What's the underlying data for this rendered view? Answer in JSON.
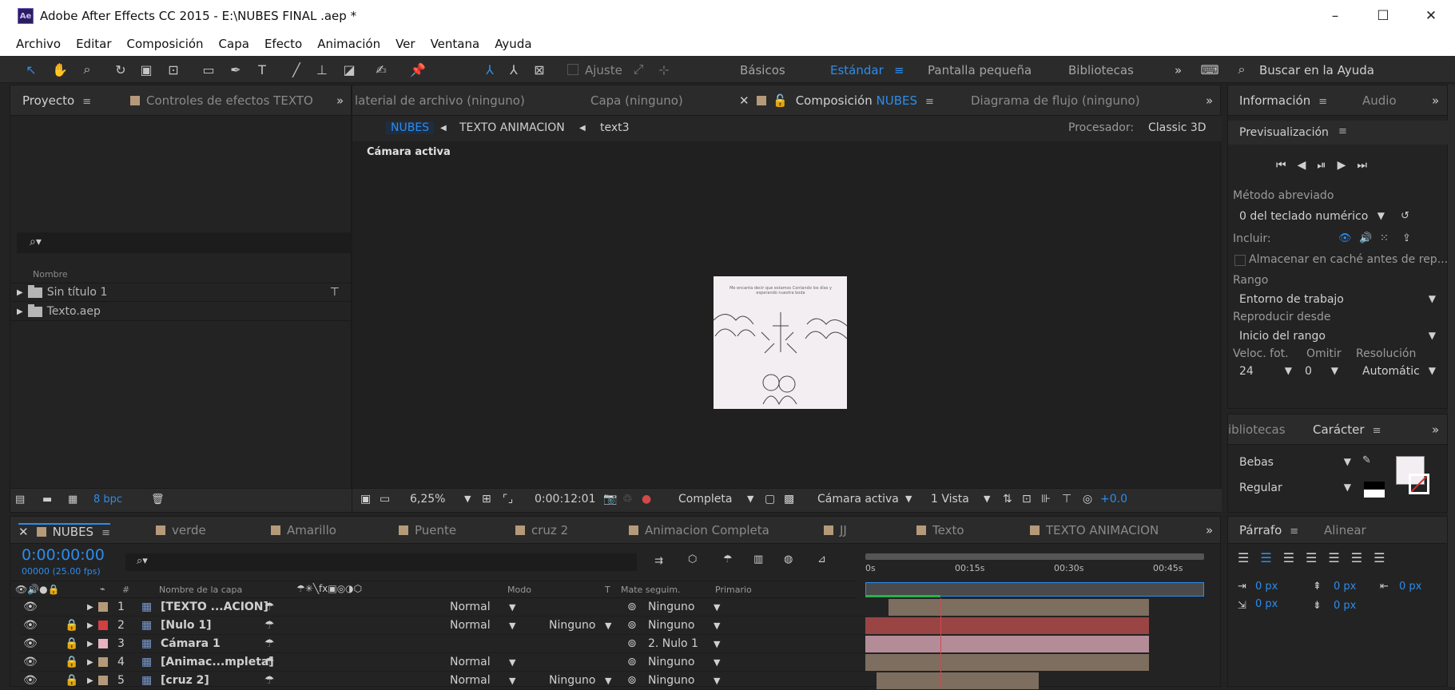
{
  "window": {
    "title": "Adobe After Effects CC 2015 - E:\\NUBES FINAL .aep *",
    "logo": "Ae",
    "min": "–",
    "max": "☐",
    "close": "✕"
  },
  "menu": [
    "Archivo",
    "Editar",
    "Composición",
    "Capa",
    "Efecto",
    "Animación",
    "Ver",
    "Ventana",
    "Ayuda"
  ],
  "toolbar": {
    "ajuste": "Ajuste",
    "workspaces": [
      "Básicos",
      "Estándar",
      "Pantalla pequeña",
      "Bibliotecas"
    ],
    "active_workspace": "Estándar",
    "more": "»",
    "search_placeholder": "Buscar en la Ayuda"
  },
  "project": {
    "tabs": [
      "Proyecto",
      "Controles de efectos TEXTO"
    ],
    "more": "»",
    "search_icon": "⌕▾",
    "column": "Nombre",
    "items": [
      "Sin título 1",
      "Texto.aep"
    ],
    "bpc": "8 bpc"
  },
  "composition": {
    "tabs": [
      "laterial de archivo (ninguno)",
      "Capa (ninguno)",
      "Composición",
      "Diagrama de flujo (ninguno)"
    ],
    "comp_name": "NUBES",
    "more": "»",
    "breadcrumb": [
      "NUBES",
      "TEXTO ANIMACION",
      "text3"
    ],
    "processor_label": "Procesador:",
    "processor_value": "Classic 3D",
    "camera_label": "Cámara activa",
    "thumb_text": "Me encanta decir que estamos Contando los días y esperando nuestra boda",
    "footer": {
      "zoom": "6,25%",
      "timecode": "0:00:12:01",
      "quality": "Completa",
      "camera": "Cámara activa",
      "views": "1 Vista",
      "exposure": "+0.0"
    }
  },
  "info_panel": {
    "tabs": [
      "Información",
      "Audio"
    ],
    "more": "»",
    "preview_title": "Previsualización",
    "shortcut_label": "Método abreviado",
    "shortcut_value": "0 del teclado numérico",
    "include_label": "Incluir:",
    "cache_label": "Almacenar en caché antes de rep...",
    "range_label": "Rango",
    "range_value": "Entorno de trabajo",
    "play_from_label": "Reproducir desde",
    "play_from_value": "Inicio del rango",
    "fps_label": "Veloc. fot.",
    "skip_label": "Omitir",
    "res_label": "Resolución",
    "fps_value": "24",
    "skip_value": "0",
    "res_value": "Automátic"
  },
  "character_panel": {
    "tabs": [
      "ibliotecas",
      "Carácter"
    ],
    "more": "»",
    "font": "Bebas",
    "style": "Regular"
  },
  "paragraph_panel": {
    "tabs": [
      "Párrafo",
      "Alinear"
    ],
    "values": [
      "0 px",
      "0 px",
      "0 px",
      "0 px",
      "0 px"
    ]
  },
  "timeline": {
    "tabs": [
      "NUBES",
      "verde",
      "Amarillo",
      "Puente",
      "cruz 2",
      "Animacion Completa",
      "JJ",
      "Texto",
      "TEXTO ANIMACION"
    ],
    "tab_colors": [
      "#b59a7a",
      "#b59a7a",
      "#b59a7a",
      "#b59a7a",
      "#b59a7a",
      "#b59a7a",
      "#b59a7a",
      "#b59a7a",
      "#b59a7a"
    ],
    "more": "»",
    "timecode": "0:00:00:00",
    "fps": "00000 (25.00 fps)",
    "columns": {
      "num": "#",
      "name": "Nombre de la capa",
      "mode": "Modo",
      "t": "T",
      "trkmat": "Mate seguim.",
      "parent": "Primario"
    },
    "ruler": [
      "0s",
      "00:15s",
      "00:30s",
      "00:45s"
    ],
    "layers": [
      {
        "num": "1",
        "name": "[TEXTO ...ACION]",
        "color": "#b59a7a",
        "mode": "Normal",
        "trkmat": "",
        "parent": "Ninguno",
        "bar_color": "#7d6e5f"
      },
      {
        "num": "2",
        "name": "[Nulo 1]",
        "color": "#d04040",
        "mode": "Normal",
        "trkmat": "Ninguno",
        "parent": "Ninguno",
        "bar_color": "#9a4444"
      },
      {
        "num": "3",
        "name": "Cámara 1",
        "color": "#e8b4c0",
        "mode": "",
        "trkmat": "",
        "parent": "2. Nulo 1",
        "bar_color": "#b48c98"
      },
      {
        "num": "4",
        "name": "[Animac...mpleta]",
        "color": "#b59a7a",
        "mode": "Normal",
        "trkmat": "",
        "parent": "Ninguno",
        "bar_color": "#7d6e5f"
      },
      {
        "num": "5",
        "name": "[cruz 2]",
        "color": "#b59a7a",
        "mode": "Normal",
        "trkmat": "Ninguno",
        "parent": "Ninguno",
        "bar_color": "#7d6e5f"
      }
    ]
  }
}
